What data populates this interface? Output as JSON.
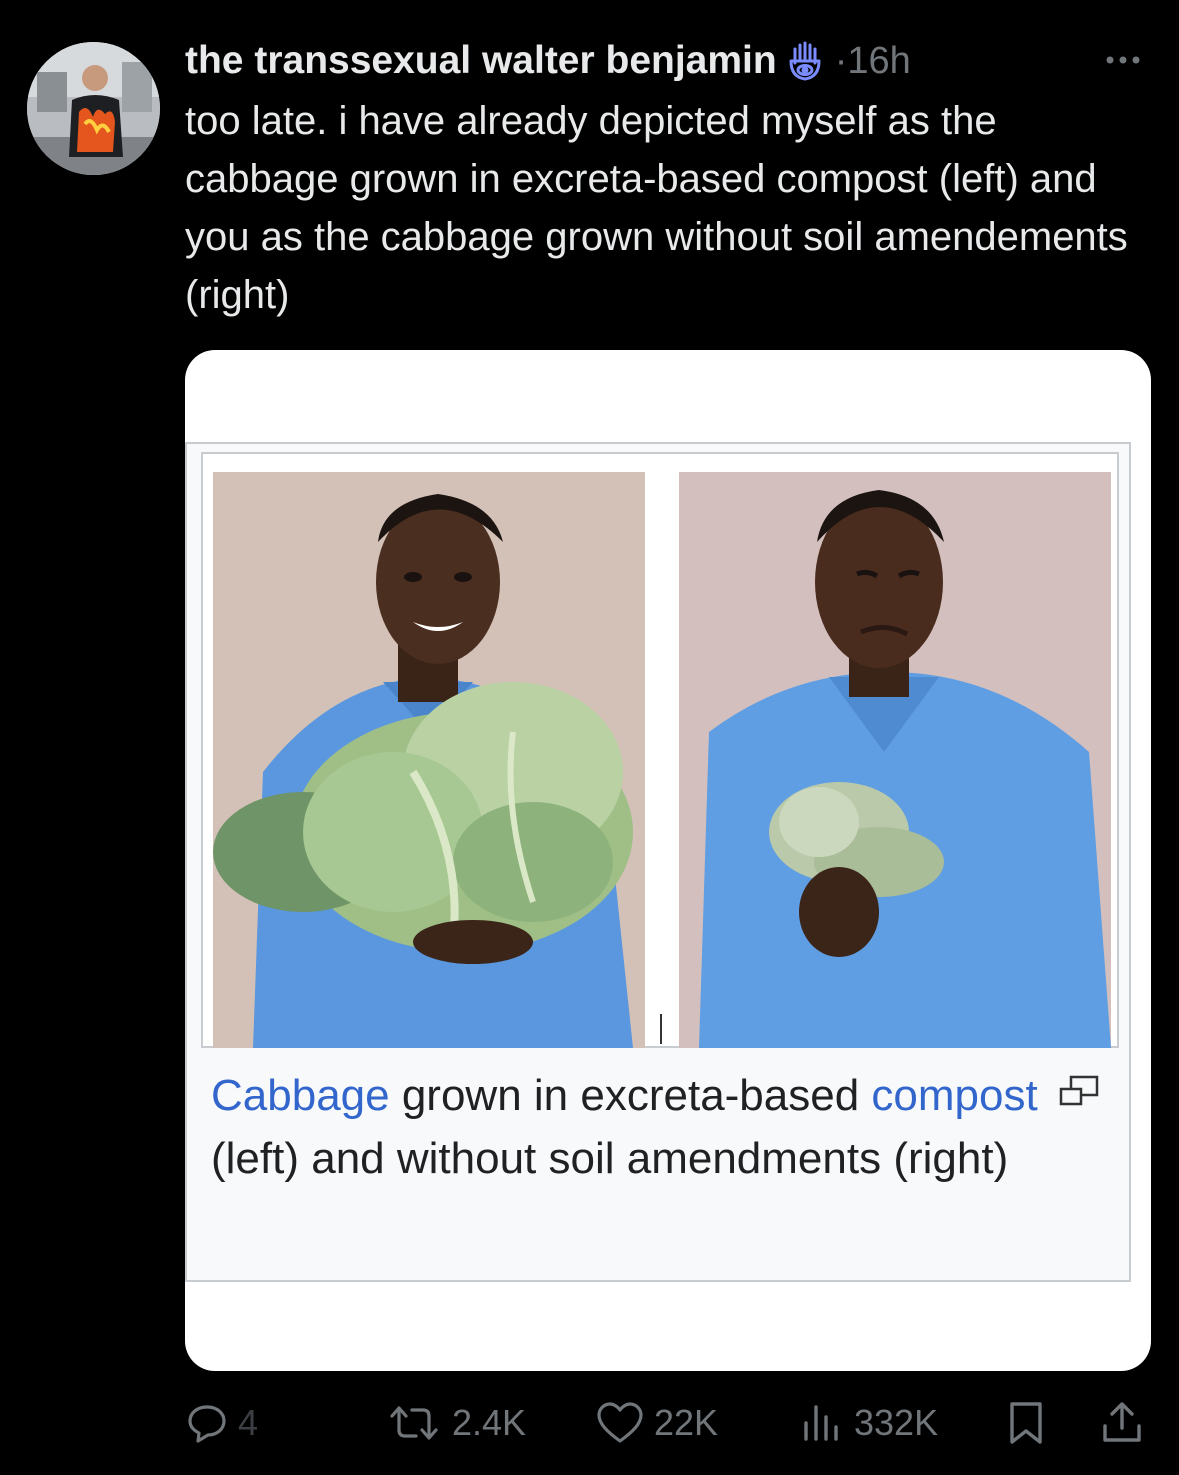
{
  "post": {
    "display_name": "the transsexual walter benjamin",
    "badge_icon": "hamsa-icon",
    "time": "·16h",
    "more_icon": "more-icon",
    "text": "too late. i have already depicted myself as the cabbage grown in excreta-based compost (left) and you as the cabbage grown without soil amendements (right)"
  },
  "embedded_image": {
    "caption_link_1": "Cabbage",
    "caption_text_1": " grown in excreta-based ",
    "caption_link_2": "compost",
    "caption_text_2": " (left) and without soil amendments (right)",
    "link_color": "#3366cc"
  },
  "actions": {
    "replies": "4",
    "reposts": "2.4K",
    "likes": "22K",
    "views": "332K"
  },
  "colors": {
    "background": "#000000",
    "text": "#e7e9ea",
    "muted": "#71767b"
  }
}
